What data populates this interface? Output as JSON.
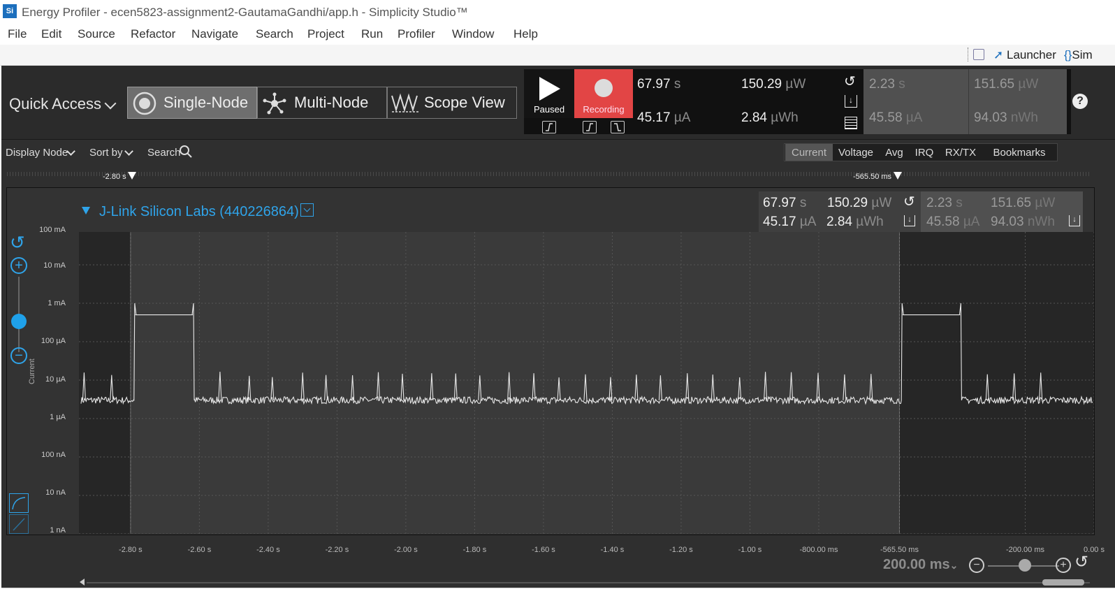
{
  "window": {
    "logo": "Si",
    "title": "Energy Profiler - ecen5823-assignment2-GautamaGandhi/app.h - Simplicity Studio™"
  },
  "menu": [
    "File",
    "Edit",
    "Source",
    "Refactor",
    "Navigate",
    "Search",
    "Project",
    "Run",
    "Profiler",
    "Window",
    "Help"
  ],
  "toolbar": {
    "launcher": "Launcher",
    "sim": "Sim"
  },
  "profiler": {
    "quick_access": "Quick Access",
    "modes": [
      "Single-Node",
      "Multi-Node",
      "Scope View"
    ],
    "active_mode": "Single-Node",
    "play": {
      "label": "Paused"
    },
    "record": {
      "label": "Recording",
      "color": "#e24545"
    },
    "totals": {
      "time": "67.97",
      "time_unit": "s",
      "current": "45.17",
      "current_unit": "µA",
      "power": "150.29",
      "power_unit": "µW",
      "energy": "2.84",
      "energy_unit": "µWh"
    },
    "selection": {
      "time": "2.23",
      "time_unit": "s",
      "current": "45.58",
      "current_unit": "µA",
      "power": "151.65",
      "power_unit": "µW",
      "energy": "94.03",
      "energy_unit": "nWh"
    },
    "help": "?"
  },
  "filterbar": {
    "display_node": "Display Node",
    "sort_by": "Sort by",
    "search": "Search",
    "tabs": [
      "Current",
      "Voltage",
      "Avg",
      "IRQ",
      "RX/TX",
      "Bookmarks"
    ],
    "active_tab": "Current"
  },
  "markers": {
    "left": "-2.80 s",
    "right": "-565.50 ms"
  },
  "node": {
    "name": "J-Link Silicon Labs (440226864)"
  },
  "chart_data": {
    "type": "line",
    "title": "",
    "xlabel": "",
    "ylabel": "Current",
    "y_scale": "log",
    "y_ticks": [
      "100 mA",
      "10 mA",
      "1 mA",
      "100 µA",
      "10 µA",
      "1 µA",
      "100 nA",
      "10 nA",
      "1 nA"
    ],
    "x_ticks": [
      "-2.80 s",
      "-2.60 s",
      "-2.40 s",
      "-2.20 s",
      "-2.00 s",
      "-1.80 s",
      "-1.60 s",
      "-1.40 s",
      "-1.20 s",
      "-1.00 s",
      "-800.00 ms",
      "-565.50 ms",
      "-200.00 ms",
      "0.00 s"
    ],
    "xlim_s": [
      -2.95,
      0.0
    ],
    "selection_s": [
      -2.8,
      -0.5655
    ],
    "baseline_uA": 3.0,
    "periodic_peak_uA": 14.0,
    "burst_level_uA": 500.0,
    "burst_peak_uA": 1000.0,
    "bursts_s": [
      [
        -2.79,
        -2.615
      ],
      [
        -0.56,
        -0.385
      ]
    ],
    "peaks_s": [
      -2.935,
      -2.855,
      -2.54,
      -2.455,
      -2.388,
      -2.3,
      -2.232,
      -2.155,
      -2.08,
      -2.01,
      -1.925,
      -1.855,
      -1.785,
      -1.7,
      -1.628,
      -1.555,
      -1.478,
      -1.405,
      -1.33,
      -1.26,
      -1.182,
      -1.108,
      -1.03,
      -0.955,
      -0.88,
      -0.802,
      -0.725,
      -0.648,
      -0.31,
      -0.232,
      -0.155
    ],
    "line_color": "#e8e8e8",
    "grid": true
  },
  "xaxis": {
    "zoom": "200.00 ms"
  }
}
